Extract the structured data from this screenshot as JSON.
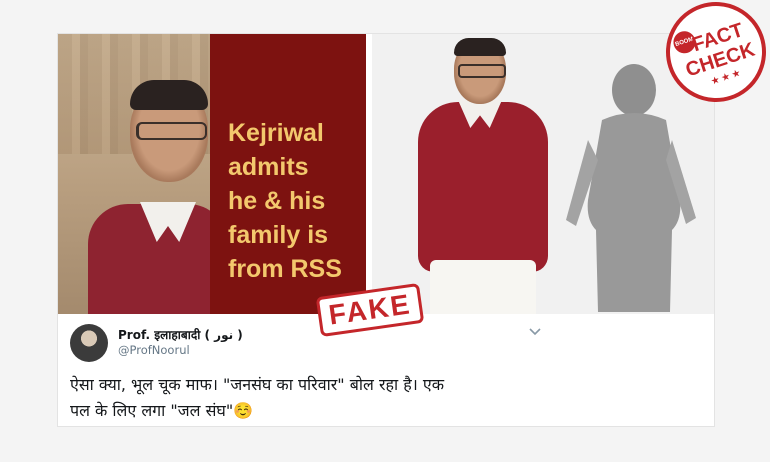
{
  "left_panel": {
    "caption_lines": [
      "Kejriwal",
      "admits",
      "he & his",
      "family is",
      "from RSS"
    ]
  },
  "stamps": {
    "fact_check_brand": "BOOM",
    "fact_check_line1": "FACT",
    "fact_check_line2": "CHECK",
    "fact_check_stars": "★★★",
    "verdict": "FAKE"
  },
  "tweet": {
    "display_name": "Prof. इलाहाबादी ( نور )",
    "handle": "@ProfNoorul",
    "text_line1": "ऐसा क्या, भूल चूक माफ। \"जनसंघ का परिवार\" बोल रहा है। एक",
    "text_line2": "पल के लिए लगा \"जल संघ\"☺️"
  },
  "colors": {
    "panel_red": "#7d1210",
    "caption_yellow": "#f3c86d",
    "stamp_red": "#c4262a"
  },
  "icons": {
    "tweet_menu": "chevron-down-icon"
  }
}
